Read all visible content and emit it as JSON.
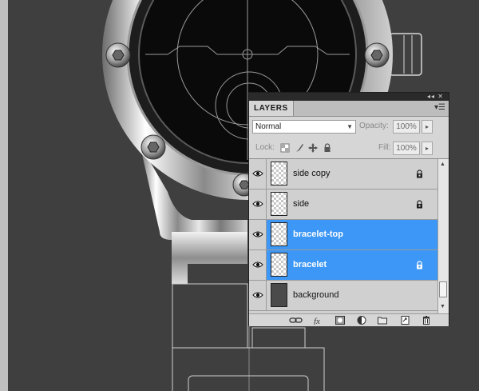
{
  "panel": {
    "tab_label": "LAYERS",
    "blend_mode": "Normal",
    "opacity_label": "Opacity:",
    "opacity_value": "100%",
    "lock_label": "Lock:",
    "fill_label": "Fill:",
    "fill_value": "100%"
  },
  "layers": [
    {
      "name": "side copy",
      "selected": false,
      "locked": true,
      "thumbnail": "transparent"
    },
    {
      "name": "side",
      "selected": false,
      "locked": true,
      "thumbnail": "transparent"
    },
    {
      "name": "bracelet-top",
      "selected": true,
      "locked": false,
      "thumbnail": "transparent"
    },
    {
      "name": "bracelet",
      "selected": true,
      "locked": true,
      "thumbnail": "transparent"
    },
    {
      "name": "background",
      "selected": false,
      "locked": false,
      "thumbnail": "dark"
    }
  ],
  "icons": {
    "visibility": "eye-icon",
    "lock": "lock-icon",
    "bottom_bar": [
      "link-layers-icon",
      "layer-style-fx-icon",
      "add-mask-icon",
      "adjustment-layer-icon",
      "new-group-folder-icon",
      "new-layer-icon",
      "delete-layer-trash-icon"
    ]
  },
  "colors": {
    "selection": "#3d97f6",
    "canvas_background": "#3f3f3f",
    "panel_background": "#d6d6d6"
  }
}
